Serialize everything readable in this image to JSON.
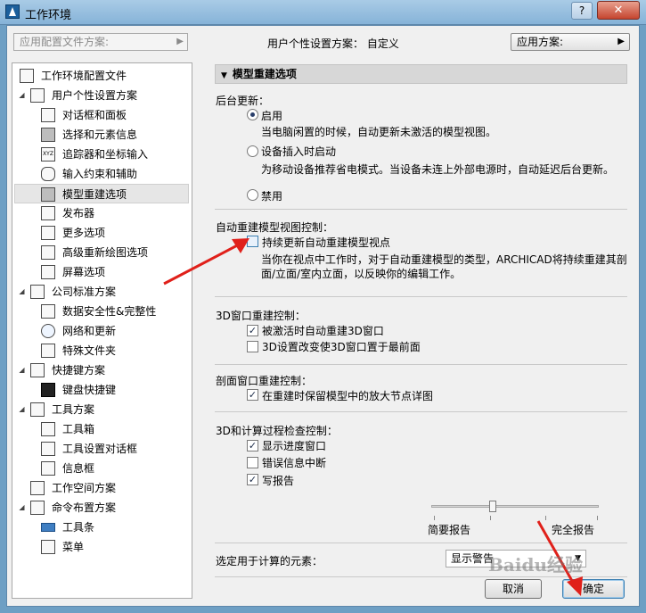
{
  "window": {
    "title": "工作环境",
    "help": "?",
    "close": "✕"
  },
  "topbar": {
    "profile_placeholder": "应用配置文件方案:",
    "profile_status": "用户个性设置方案：  自定义",
    "apply_label": "应用方案:"
  },
  "tree": {
    "items": [
      {
        "label": "工作环境配置文件",
        "icon": "monitor-icon"
      },
      {
        "label": "用户个性设置方案",
        "icon": "user-settings-icon"
      },
      {
        "label": "对话框和面板",
        "icon": "dialog-icon"
      },
      {
        "label": "选择和元素信息",
        "icon": "selection-icon"
      },
      {
        "label": "追踪器和坐标输入",
        "icon": "xyz-icon"
      },
      {
        "label": "输入约束和辅助",
        "icon": "mouse-icon"
      },
      {
        "label": "模型重建选项",
        "icon": "model-rebuild-icon"
      },
      {
        "label": "发布器",
        "icon": "publisher-icon"
      },
      {
        "label": "更多选项",
        "icon": "sliders-icon"
      },
      {
        "label": "高级重新绘图选项",
        "icon": "redraw-icon"
      },
      {
        "label": "屏幕选项",
        "icon": "screen-icon"
      },
      {
        "label": "公司标准方案",
        "icon": "company-icon"
      },
      {
        "label": "数据安全性&完整性",
        "icon": "data-safety-icon"
      },
      {
        "label": "网络和更新",
        "icon": "globe-icon"
      },
      {
        "label": "特殊文件夹",
        "icon": "folder-icon"
      },
      {
        "label": "快捷键方案",
        "icon": "shortcut-icon"
      },
      {
        "label": "键盘快捷键",
        "icon": "keyboard-icon"
      },
      {
        "label": "工具方案",
        "icon": "tools-icon"
      },
      {
        "label": "工具箱",
        "icon": "toolbox-icon"
      },
      {
        "label": "工具设置对话框",
        "icon": "tool-settings-icon"
      },
      {
        "label": "信息框",
        "icon": "infobox-icon"
      },
      {
        "label": "工作空间方案",
        "icon": "workspace-icon"
      },
      {
        "label": "命令布置方案",
        "icon": "command-layout-icon"
      },
      {
        "label": "工具条",
        "icon": "toolbar-icon"
      },
      {
        "label": "菜单",
        "icon": "menu-icon"
      }
    ]
  },
  "panel": {
    "section_title": "模型重建选项",
    "background_update": {
      "label": "后台更新：",
      "opt_enable": "启用",
      "opt_enable_desc": "当电脑闲置的时候，自动更新未激活的模型视图。",
      "opt_device": "设备插入时启动",
      "opt_device_desc": "为移动设备推荐省电模式。当设备未连上外部电源时，自动延迟后台更新。",
      "opt_disable": "禁用",
      "selected": "启用"
    },
    "auto_rebuild": {
      "label": "自动重建模型视图控制：",
      "checkbox": "持续更新自动重建模型视点",
      "checked": false,
      "desc1": "当你在视点中工作时，对于自动重建模型的类型，ARCHICAD将持续重建其剖",
      "desc2": "面/立面/室内立面，以反映你的编辑工作。"
    },
    "window3d": {
      "label": "3D窗口重建控制：",
      "opt1": "被激活时自动重建3D窗口",
      "opt1_checked": true,
      "opt2": "3D设置改变使3D窗口置于最前面",
      "opt2_checked": false
    },
    "section_rebuild": {
      "label": "剖面窗口重建控制：",
      "opt1": "在重建时保留模型中的放大节点详图",
      "opt1_checked": true
    },
    "progress": {
      "label": "3D和计算过程检查控制：",
      "opt1": "显示进度窗口",
      "opt1_checked": true,
      "opt2": "错误信息中断",
      "opt2_checked": false,
      "opt3": "写报告",
      "opt3_checked": true,
      "slider_min": "简要报告",
      "slider_max": "完全报告",
      "slider_level": 0.33
    },
    "calc": {
      "label": "选定用于计算的元素：",
      "value": "显示警告"
    }
  },
  "buttons": {
    "cancel": "取消",
    "ok": "确定"
  },
  "watermark": "Baidu经验",
  "colors": {
    "annotation_arrow": "#e0201a",
    "selection": "#e6e6e6"
  }
}
